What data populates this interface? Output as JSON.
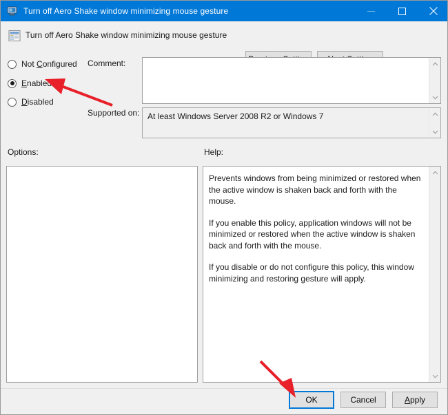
{
  "window": {
    "title": "Turn off Aero Shake window minimizing mouse gesture",
    "icon": "computer-monitor-icon",
    "controls": {
      "minimize": "minimize-icon",
      "maximize": "maximize-icon",
      "close": "close-icon"
    }
  },
  "header": {
    "icon": "policy-setting-icon",
    "title": "Turn off Aero Shake window minimizing mouse gesture",
    "previous_setting": "Previous Setting",
    "previous_setting_accel": "P",
    "next_setting": "Next Setting",
    "next_setting_accel": "N"
  },
  "state_options": [
    {
      "label": "Not Configured",
      "accel": "C",
      "selected": false
    },
    {
      "label": "Enabled",
      "accel": "E",
      "selected": true
    },
    {
      "label": "Disabled",
      "accel": "D",
      "selected": false
    }
  ],
  "comment": {
    "label": "Comment:",
    "value": "",
    "placeholder": ""
  },
  "supported_on": {
    "label": "Supported on:",
    "value": "At least Windows Server 2008 R2 or Windows 7"
  },
  "options": {
    "label": "Options:",
    "value": ""
  },
  "help": {
    "label": "Help:",
    "paragraphs": [
      "Prevents windows from being minimized or restored when the active window is shaken back and forth with the mouse.",
      "If you enable this policy, application windows will not be minimized or restored when the active window is shaken back and forth with the mouse.",
      "If you disable or do not configure this policy, this window minimizing and restoring gesture will apply."
    ]
  },
  "footer": {
    "ok": "OK",
    "cancel": "Cancel",
    "apply": "Apply",
    "apply_accel": "A"
  },
  "annotations": [
    {
      "name": "arrow-to-enabled-radio",
      "color": "#e8202a"
    },
    {
      "name": "arrow-to-ok-button",
      "color": "#e8202a"
    }
  ],
  "colors": {
    "titlebar": "#0078d7",
    "dialog_background": "#f0f0f0",
    "focus_border": "#0078d7",
    "annotation_red": "#e8202a"
  }
}
